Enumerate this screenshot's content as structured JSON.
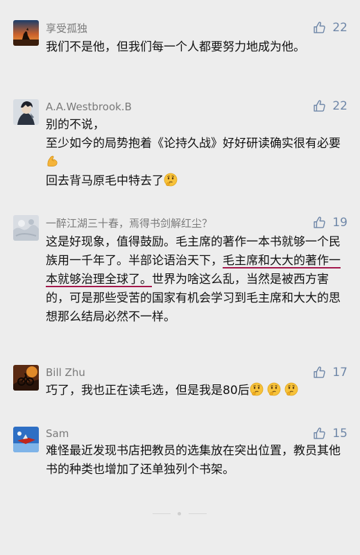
{
  "comments": [
    {
      "user": "享受孤独",
      "likes": "22",
      "lines": [
        "我们不是他，但我们每一个人都要努力地成为他。"
      ]
    },
    {
      "user": "A.A.Westbrook.B",
      "likes": "22",
      "lines": [
        "别的不说，",
        "至少如今的局势抱着《论持久战》好好研读确实很有必要",
        "回去背马原毛中特去了"
      ]
    },
    {
      "user": "一醉江湖三十春，焉得书剑解红尘？",
      "likes": "19",
      "text_a": "这是好现象，值得鼓励。毛主席的著作一本书就够一个民族用一千年了。半部论语治天下，",
      "text_underlined": "毛主席和大大的著作一本就够治理全球了。",
      "text_b": "世界为啥这么乱，当然是被西方害的，可是那些受苦的国家有机会学习到毛主席和大大的思想那么结局必然不一样。"
    },
    {
      "user": "Bill Zhu",
      "likes": "17",
      "lines": [
        "巧了，我也正在读毛选，但是我是80后"
      ]
    },
    {
      "user": "Sam",
      "likes": "15",
      "lines": [
        "难怪最近发现书店把教员的选集放在突出位置，教员其他书的种类也增加了还单独列个书架。"
      ]
    }
  ],
  "colors": {
    "background": "#ededed",
    "username": "#7a7a7a",
    "like": "#6f87a8",
    "underline": "#a3164a"
  },
  "icons": {
    "like": "thumbs-up-icon",
    "flex": "flexed-biceps-emoji",
    "think": "thinking-face-emoji"
  }
}
